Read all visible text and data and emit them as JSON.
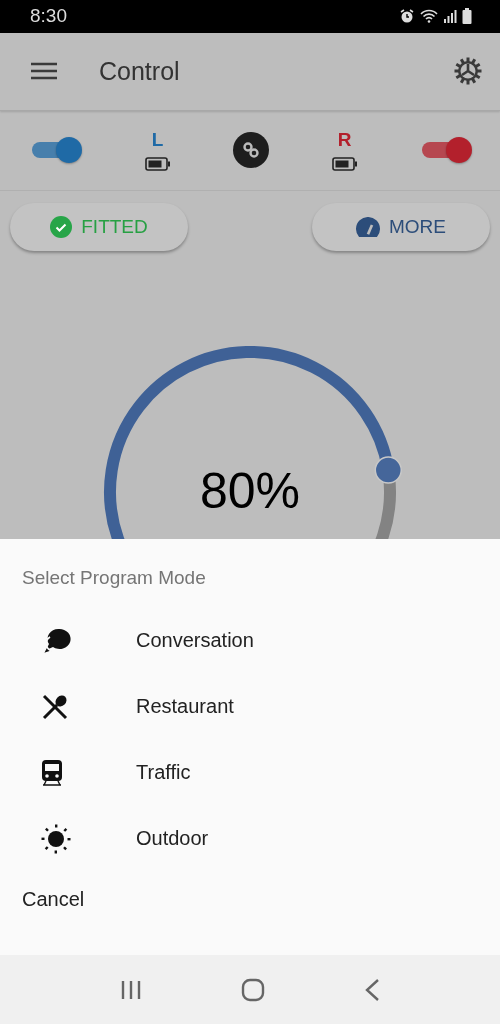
{
  "status_bar": {
    "time": "8:30"
  },
  "app_bar": {
    "title": "Control"
  },
  "sides": [
    {
      "label": "L",
      "on": true,
      "color": "#1f6aa6"
    },
    {
      "label": "R",
      "on": true,
      "color": "#b3202c"
    }
  ],
  "buttons": [
    {
      "kind": "fitted",
      "label": "FITTED"
    },
    {
      "kind": "more",
      "label": "MORE"
    }
  ],
  "volume": {
    "reading": "80%"
  },
  "sheet": {
    "title": "Select Program Mode",
    "items": [
      {
        "kind": "conversation",
        "label": "Conversation"
      },
      {
        "kind": "restaurant",
        "label": "Restaurant"
      },
      {
        "kind": "traffic",
        "label": "Traffic"
      },
      {
        "kind": "outdoor",
        "label": "Outdoor"
      }
    ],
    "cancel": "Cancel"
  }
}
